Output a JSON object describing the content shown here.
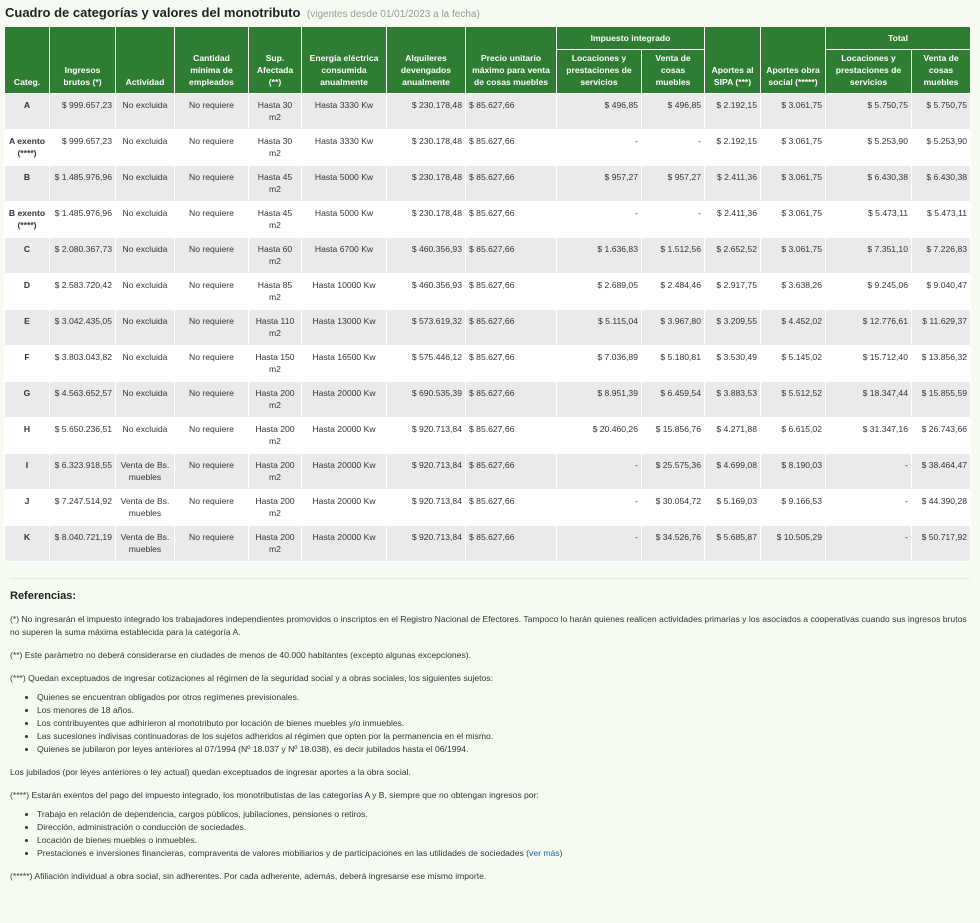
{
  "title": "Cuadro de categorías y valores del monotributo",
  "subtitle": "(vigentes desde 01/01/2023 a la fecha)",
  "headers": {
    "impuesto_group": "Impuesto integrado",
    "total_group": "Total",
    "categ": "Categ.",
    "ingresos": "Ingresos brutos (*)",
    "actividad": "Actividad",
    "empleados": "Cantidad mínima de empleados",
    "superficie": "Sup. Afectada (**)",
    "energia": "Energía eléctrica consumida anualmente",
    "alquileres": "Alquileres devengados anualmente",
    "precio": "Precio unitario máximo para venta de cosas muebles",
    "imp_servicios": "Locaciones y prestaciones de servicios",
    "imp_venta": "Venta de cosas muebles",
    "sipa": "Aportes al SIPA (***)",
    "obra_social": "Aportes obra social (*****)",
    "tot_servicios": "Locaciones y prestaciones de servicios",
    "tot_venta": "Venta de cosas muebles"
  },
  "rows": [
    {
      "cat": "A",
      "ingresos": "$ 999.657,23",
      "actividad": "No excluida",
      "empleados": "No requiere",
      "sup": "Hasta 30 m2",
      "energia": "Hasta 3330 Kw",
      "alquileres": "$ 230.178,48",
      "precio": "$ 85.627,66",
      "imp_serv": "$ 496,85",
      "imp_venta": "$ 496,85",
      "sipa": "$ 2.192,15",
      "obra": "$ 3.061,75",
      "tot_serv": "$ 5.750,75",
      "tot_venta": "$ 5.750,75"
    },
    {
      "cat": "A exento (****)",
      "ingresos": "$ 999.657,23",
      "actividad": "No excluida",
      "empleados": "No requiere",
      "sup": "Hasta 30 m2",
      "energia": "Hasta 3330 Kw",
      "alquileres": "$ 230.178,48",
      "precio": "$ 85.627,66",
      "imp_serv": "-",
      "imp_venta": "-",
      "sipa": "$ 2.192,15",
      "obra": "$ 3.061,75",
      "tot_serv": "$ 5.253,90",
      "tot_venta": "$ 5.253,90"
    },
    {
      "cat": "B",
      "ingresos": "$ 1.485.976,96",
      "actividad": "No excluida",
      "empleados": "No requiere",
      "sup": "Hasta 45 m2",
      "energia": "Hasta 5000 Kw",
      "alquileres": "$ 230.178,48",
      "precio": "$ 85.627,66",
      "imp_serv": "$ 957,27",
      "imp_venta": "$ 957,27",
      "sipa": "$ 2.411,36",
      "obra": "$ 3.061,75",
      "tot_serv": "$ 6.430,38",
      "tot_venta": "$ 6.430,38"
    },
    {
      "cat": "B exento (****)",
      "ingresos": "$ 1.485.976,96",
      "actividad": "No excluida",
      "empleados": "No requiere",
      "sup": "Hasta 45 m2",
      "energia": "Hasta 5000 Kw",
      "alquileres": "$ 230.178,48",
      "precio": "$ 85.627,66",
      "imp_serv": "-",
      "imp_venta": "-",
      "sipa": "$ 2.411,36",
      "obra": "$ 3.061,75",
      "tot_serv": "$ 5.473,11",
      "tot_venta": "$ 5.473,11"
    },
    {
      "cat": "C",
      "ingresos": "$ 2.080.367,73",
      "actividad": "No excluida",
      "empleados": "No requiere",
      "sup": "Hasta 60 m2",
      "energia": "Hasta 6700 Kw",
      "alquileres": "$ 460.356,93",
      "precio": "$ 85.627,66",
      "imp_serv": "$ 1.636,83",
      "imp_venta": "$ 1.512,56",
      "sipa": "$ 2.652,52",
      "obra": "$ 3.061,75",
      "tot_serv": "$ 7.351,10",
      "tot_venta": "$ 7.226,83"
    },
    {
      "cat": "D",
      "ingresos": "$ 2.583.720,42",
      "actividad": "No excluida",
      "empleados": "No requiere",
      "sup": "Hasta 85 m2",
      "energia": "Hasta 10000 Kw",
      "alquileres": "$ 460.356,93",
      "precio": "$ 85.627,66",
      "imp_serv": "$ 2.689,05",
      "imp_venta": "$ 2.484,46",
      "sipa": "$ 2.917,75",
      "obra": "$ 3.638,26",
      "tot_serv": "$ 9.245,06",
      "tot_venta": "$ 9.040,47"
    },
    {
      "cat": "E",
      "ingresos": "$ 3.042.435,05",
      "actividad": "No excluida",
      "empleados": "No requiere",
      "sup": "Hasta 110 m2",
      "energia": "Hasta 13000 Kw",
      "alquileres": "$ 573.619,32",
      "precio": "$ 85.627,66",
      "imp_serv": "$ 5.115,04",
      "imp_venta": "$ 3.967,80",
      "sipa": "$ 3.209,55",
      "obra": "$ 4.452,02",
      "tot_serv": "$ 12.776,61",
      "tot_venta": "$ 11.629,37"
    },
    {
      "cat": "F",
      "ingresos": "$ 3.803.043,82",
      "actividad": "No excluida",
      "empleados": "No requiere",
      "sup": "Hasta 150 m2",
      "energia": "Hasta 16500 Kw",
      "alquileres": "$ 575.446,12",
      "precio": "$ 85.627,66",
      "imp_serv": "$ 7.036,89",
      "imp_venta": "$ 5.180,81",
      "sipa": "$ 3.530,49",
      "obra": "$ 5.145,02",
      "tot_serv": "$ 15.712,40",
      "tot_venta": "$ 13.856,32"
    },
    {
      "cat": "G",
      "ingresos": "$ 4.563.652,57",
      "actividad": "No excluida",
      "empleados": "No requiere",
      "sup": "Hasta 200 m2",
      "energia": "Hasta 20000 Kw",
      "alquileres": "$ 690.535,39",
      "precio": "$ 85.627,66",
      "imp_serv": "$ 8.951,39",
      "imp_venta": "$ 6.459,54",
      "sipa": "$ 3.883,53",
      "obra": "$ 5.512,52",
      "tot_serv": "$ 18.347,44",
      "tot_venta": "$ 15.855,59"
    },
    {
      "cat": "H",
      "ingresos": "$ 5.650.236,51",
      "actividad": "No excluida",
      "empleados": "No requiere",
      "sup": "Hasta 200 m2",
      "energia": "Hasta 20000 Kw",
      "alquileres": "$ 920.713,84",
      "precio": "$ 85.627,66",
      "imp_serv": "$ 20.460,26",
      "imp_venta": "$ 15.856,76",
      "sipa": "$ 4.271,88",
      "obra": "$ 6.615,02",
      "tot_serv": "$ 31.347,16",
      "tot_venta": "$ 26.743,66"
    },
    {
      "cat": "I",
      "ingresos": "$ 6.323.918,55",
      "actividad": "Venta de Bs. muebles",
      "empleados": "No requiere",
      "sup": "Hasta 200 m2",
      "energia": "Hasta 20000 Kw",
      "alquileres": "$ 920.713,84",
      "precio": "$ 85.627,66",
      "imp_serv": "-",
      "imp_venta": "$ 25.575,36",
      "sipa": "$ 4.699,08",
      "obra": "$ 8.190,03",
      "tot_serv": "-",
      "tot_venta": "$ 38.464,47"
    },
    {
      "cat": "J",
      "ingresos": "$ 7.247.514,92",
      "actividad": "Venta de Bs. muebles",
      "empleados": "No requiere",
      "sup": "Hasta 200 m2",
      "energia": "Hasta 20000 Kw",
      "alquileres": "$ 920.713,84",
      "precio": "$ 85.627,66",
      "imp_serv": "-",
      "imp_venta": "$ 30.054,72",
      "sipa": "$ 5.169,03",
      "obra": "$ 9.166,53",
      "tot_serv": "-",
      "tot_venta": "$ 44.390,28"
    },
    {
      "cat": "K",
      "ingresos": "$ 8.040.721,19",
      "actividad": "Venta de Bs. muebles",
      "empleados": "No requiere",
      "sup": "Hasta 200 m2",
      "energia": "Hasta 20000 Kw",
      "alquileres": "$ 920.713,84",
      "precio": "$ 85.627,66",
      "imp_serv": "-",
      "imp_venta": "$ 34.526,76",
      "sipa": "$ 5.685,87",
      "obra": "$ 10.505,29",
      "tot_serv": "-",
      "tot_venta": "$ 50.717,92"
    }
  ],
  "refs": {
    "heading": "Referencias:",
    "p1": "(*) No ingresarán el impuesto integrado los trabajadores independientes promovidos o inscriptos en el Registro Nacional de Efectores. Tampoco lo harán quienes realicen actividades primarias y los asociados a cooperativas cuando sus ingresos brutos no superen la suma máxima establecida para la categoría A.",
    "p2": "(**) Este parámetro no deberá considerarse en ciudades de menos de 40.000 habitantes (excepto algunas excepciones).",
    "p3": "(***) Quedan exceptuados de ingresar cotizaciones al régimen de la seguridad social y a obras sociales, los siguientes sujetos:",
    "list3": [
      "Quienes se encuentran obligados por otros regímenes previsionales.",
      "Los menores de 18 años.",
      "Los contribuyentes que adhirieron al monotributo por locación de bienes muebles y/o inmuebles.",
      "Las sucesiones indivisas continuadoras de los sujetos adheridos al régimen que opten por la permanencia en el mismo.",
      "Quienes se jubilaron por leyes anteriores al 07/1994 (Nº 18.037 y Nº 18.038), es decir jubilados hasta el 06/1994."
    ],
    "p4": "Los jubilados (por leyes anteriores o ley actual) quedan exceptuados de ingresar aportes a la obra social.",
    "p5": "(****) Estarán exentos del pago del impuesto integrado, los monotributistas de las categorías A y B, siempre que no obtengan ingresos por:",
    "list5": [
      "Trabajo en relación de dependencia, cargos públicos, jubilaciones, pensiones o retiros.",
      "Dirección, administración o conducción de sociedades.",
      "Locación de bienes muebles o inmuebles."
    ],
    "list5_last": "Prestaciones e inversiones financieras, compraventa de valores mobiliarios y de participaciones en las utilidades de sociedades (",
    "link_text": "ver más",
    "list5_close": ")",
    "p6": "(*****) Afiliación individual a obra social, sin adherentes. Por cada adherente, además, deberá ingresarse ese mismo importe."
  }
}
